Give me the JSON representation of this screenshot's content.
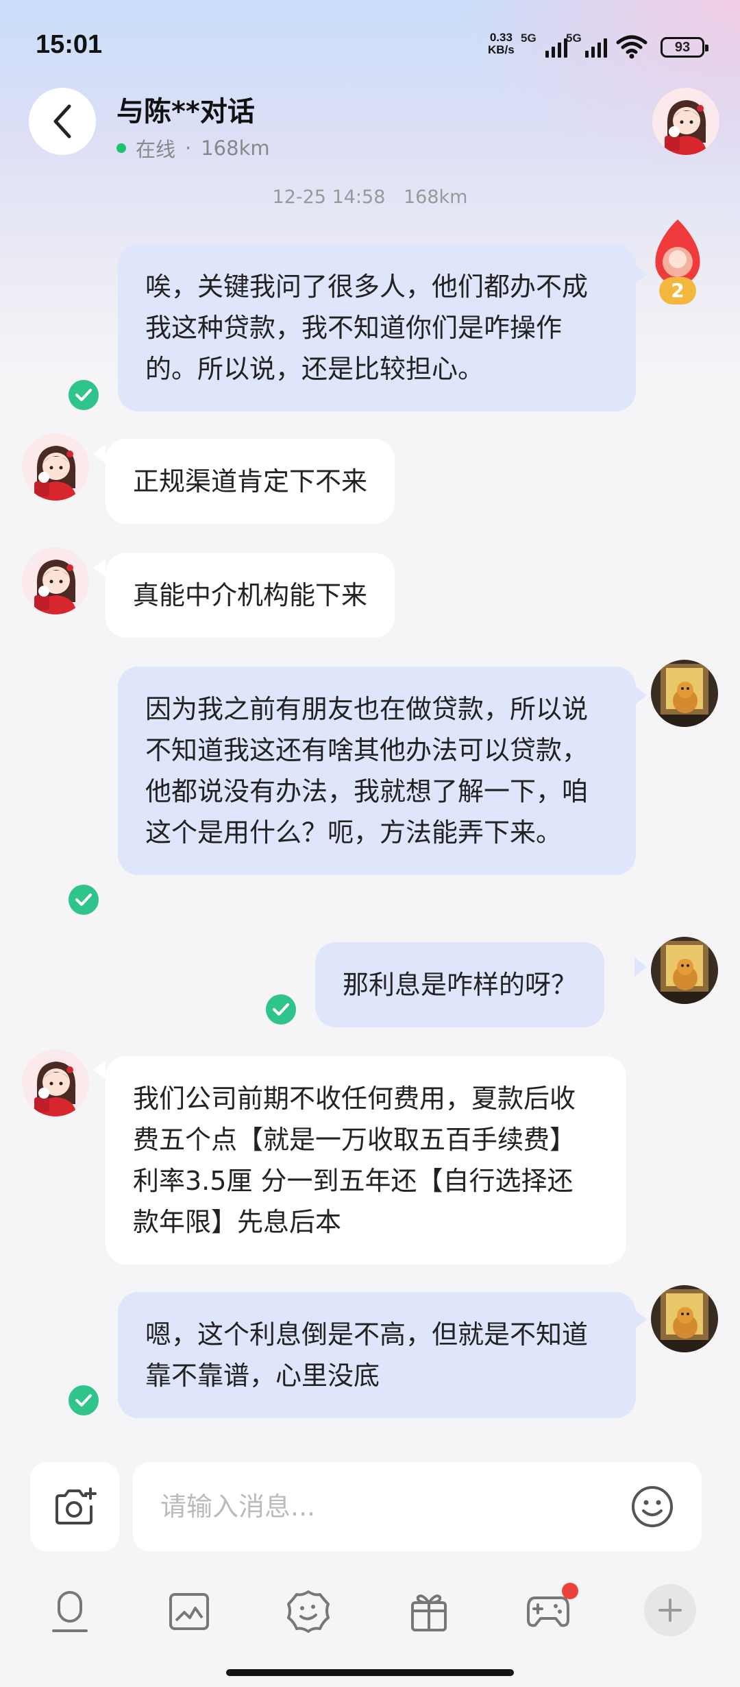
{
  "status_bar": {
    "time": "15:01",
    "net_speed_value": "0.33",
    "net_speed_unit": "KB/s",
    "sim1_label": "5G",
    "sim2_label": "5G",
    "battery": "93"
  },
  "header": {
    "title": "与陈**对话",
    "status": "在线",
    "separator": "·",
    "distance": "168km"
  },
  "timestamp": {
    "time": "12-25 14:58",
    "location": "168km"
  },
  "notification_badge": {
    "count": "2"
  },
  "messages": [
    {
      "side": "out",
      "text": "唉，关键我问了很多人，他们都办不成我这种贷款，我不知道你们是咋操作的。所以说，还是比较担心。",
      "read": true
    },
    {
      "side": "in",
      "text": "正规渠道肯定下不来"
    },
    {
      "side": "in",
      "text": "真能中介机构能下来"
    },
    {
      "side": "out",
      "text": "因为我之前有朋友也在做贷款，所以说不知道我这还有啥其他办法可以贷款，他都说没有办法，我就想了解一下，咱这个是用什么？呃，方法能弄下来。",
      "read": true
    },
    {
      "side": "out",
      "text": "那利息是咋样的呀？",
      "read": true
    },
    {
      "side": "in",
      "text": "我们公司前期不收任何费用，夏款后收费五个点【就是一万收取五百手续费】利率3.5厘  分一到五年还【自行选择还款年限】先息后本"
    },
    {
      "side": "out",
      "text": "嗯，这个利息倒是不高，但就是不知道靠不靠谱，心里没底",
      "read": true
    }
  ],
  "input": {
    "placeholder": "请输入消息..."
  },
  "toolbar": {
    "icons": [
      "voice-icon",
      "image-icon",
      "sticker-icon",
      "gift-icon",
      "game-icon",
      "plus-icon"
    ],
    "game_has_notification": true
  },
  "colors": {
    "outgoing_bubble": "#dfe5fb",
    "incoming_bubble": "#ffffff",
    "read_check": "#2ec48a",
    "online_dot": "#21c46b",
    "notification_dot": "#f03d3d"
  }
}
